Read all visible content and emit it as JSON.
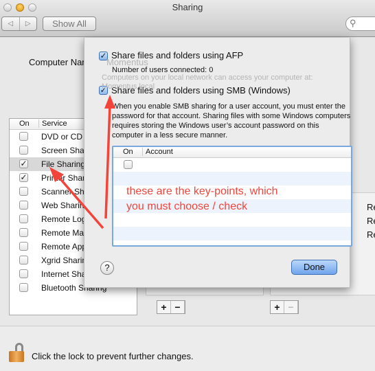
{
  "window": {
    "title": "Sharing",
    "show_all": "Show All",
    "back": "◁",
    "forward": "▷",
    "search_icon": "search-icon"
  },
  "computer_name": {
    "label": "Computer Name:",
    "value": "Momentus",
    "desc": "Computers on your local network can access your computer at: Momentus.local"
  },
  "services": {
    "col_on": "On",
    "col_service": "Service",
    "items": [
      {
        "label": "DVD or CD Sharing",
        "on": false
      },
      {
        "label": "Screen Sharing",
        "on": false
      },
      {
        "label": "File Sharing",
        "on": true
      },
      {
        "label": "Printer Sharing",
        "on": true
      },
      {
        "label": "Scanner Sharing",
        "on": false
      },
      {
        "label": "Web Sharing",
        "on": false
      },
      {
        "label": "Remote Login",
        "on": false
      },
      {
        "label": "Remote Management",
        "on": false
      },
      {
        "label": "Remote Apple Events",
        "on": false
      },
      {
        "label": "Xgrid Sharing",
        "on": false
      },
      {
        "label": "Internet Sharing",
        "on": false
      },
      {
        "label": "Bluetooth Sharing",
        "on": false
      }
    ]
  },
  "background_right": {
    "perm_items": [
      "Re",
      "Re",
      "Re"
    ],
    "plus": "+",
    "minus": "−"
  },
  "sheet": {
    "afp_label": "Share files and folders using AFP",
    "afp_checked": true,
    "afp_users": "Number of users connected: 0",
    "smb_label": "Share files and folders using SMB (Windows)",
    "smb_checked": true,
    "smb_desc": "When you enable SMB sharing for a user account, you must enter the password for that account. Sharing files with some Windows computers requires storing the Windows user’s account password on this computer in a less secure manner.",
    "table": {
      "col_on": "On",
      "col_account": "Account",
      "rows": [
        {
          "on": false,
          "account": ""
        }
      ]
    },
    "help": "?",
    "done": "Done"
  },
  "annotation": {
    "line1": "these are the key-points, which",
    "line2": "you must choose / check",
    "color": "#f2443a"
  },
  "footer": {
    "lock_text": "Click the lock to prevent further changes.",
    "lock_icon": "lock-open-icon"
  }
}
